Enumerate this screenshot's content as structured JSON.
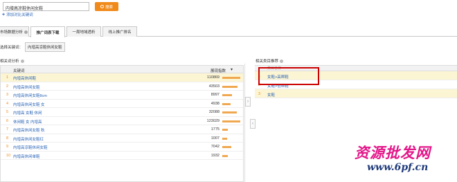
{
  "search": {
    "value": "内增高凉鞋休闲女鞋",
    "button_label": "搜索",
    "add_compare": "添加对比关键词"
  },
  "tabs": [
    {
      "label": "市场数据分析"
    },
    {
      "label": "推广词表下载"
    },
    {
      "label": "一周地域透析"
    },
    {
      "label": "线上推广排名"
    }
  ],
  "keyword_select": {
    "label": "选择关键词：",
    "chip": "内增高凉鞋休闲女鞋"
  },
  "left_section": {
    "title": "相关词分析",
    "col_keyword": "关键词",
    "col_index": "展现指数",
    "rows": [
      {
        "rank": "1",
        "keyword": "内增高休闲鞋",
        "index": "110869",
        "pct": 1.0
      },
      {
        "rank": "2",
        "keyword": "内增高休闲女鞋",
        "index": "43503",
        "pct": 0.85
      },
      {
        "rank": "3",
        "keyword": "内增高休闲女鞋8cm",
        "index": "8997",
        "pct": 0.55
      },
      {
        "rank": "4",
        "keyword": "内增高休闲女鞋 女",
        "index": "4938",
        "pct": 0.45
      },
      {
        "rank": "5",
        "keyword": "内增高 女鞋 休闲",
        "index": "32088",
        "pct": 0.8
      },
      {
        "rank": "6",
        "keyword": "休闲鞋 女 内增高",
        "index": "123029",
        "pct": 1.0
      },
      {
        "rank": "7",
        "keyword": "内增高休闲女鞋 秋",
        "index": "1775",
        "pct": 0.3
      },
      {
        "rank": "8",
        "keyword": "内增高休闲女鞋红",
        "index": "1007",
        "pct": 0.25
      },
      {
        "rank": "9",
        "keyword": "内增高凉鞋休闲女鞋",
        "index": "7042",
        "pct": 0.5
      },
      {
        "rank": "10",
        "keyword": "内增高休闲单鞋",
        "index": "1932",
        "pct": 0.3
      }
    ]
  },
  "right_section": {
    "title": "相关类目推荐",
    "col_category": "类目名称",
    "rows": [
      {
        "rank": "1",
        "category": "女鞋>高帮鞋"
      },
      {
        "rank": "2",
        "category": "女鞋>低帮鞋"
      },
      {
        "rank": "3",
        "category": "女鞋"
      }
    ]
  },
  "divider_arrows": {
    "left": "‹",
    "right": "›"
  },
  "watermark": {
    "line1": "资源批发网",
    "line2": "www.6pf.cn"
  },
  "colors": {
    "accent": "#f08a1a",
    "link": "#2a64b6",
    "highlight": "#fcf5d3",
    "red_box": "#cc0000"
  }
}
